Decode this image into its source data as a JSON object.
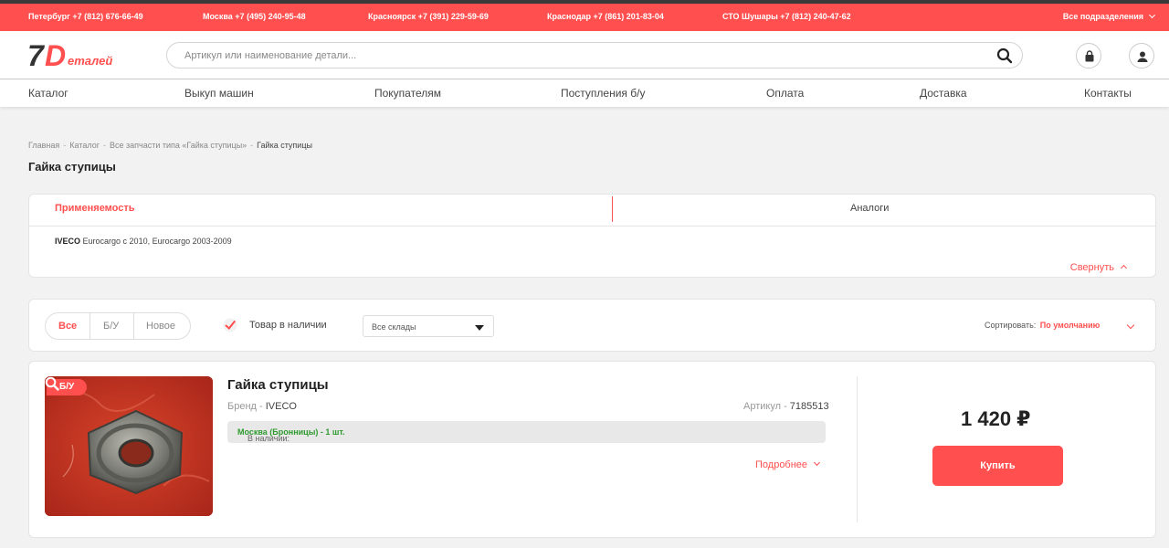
{
  "topbar": {
    "phones": [
      "Петербург +7 (812) 676-66-49",
      "Москва +7 (495) 240-95-48",
      "Красноярск +7 (391) 229-59-69",
      "Краснодар +7 (861) 201-83-04",
      "СТО Шушары +7 (812) 240-47-62"
    ],
    "all_divisions": "Все подразделения"
  },
  "logo": {
    "seven": "7",
    "d": "D",
    "rest": "еталей"
  },
  "search": {
    "placeholder": "Артикул или наименование детали..."
  },
  "nav": [
    "Каталог",
    "Выкуп машин",
    "Покупателям",
    "Поступления б/у",
    "Оплата",
    "Доставка",
    "Контакты"
  ],
  "breadcrumb": {
    "items": [
      "Главная",
      "Каталог",
      "Все запчасти типа «Гайка ступицы»"
    ],
    "current": "Гайка ступицы"
  },
  "page_title": "Гайка ступицы",
  "applicability": {
    "tab_active": "Применяемость",
    "tab_other": "Аналоги",
    "brand": "IVECO",
    "models": "Eurocargo с 2010, Eurocargo 2003-2009",
    "collapse": "Свернуть"
  },
  "filters": {
    "segments": [
      "Все",
      "Б/У",
      "Новое"
    ],
    "in_stock": "Товар в наличии",
    "warehouse": "Все склады",
    "sort_label": "Сортировать:",
    "sort_value": "По умолчанию"
  },
  "product": {
    "badge": "Б/У",
    "title": "Гайка ступицы",
    "brand_label": "Бренд - ",
    "brand": "IVECO",
    "article_label": "Артикул - ",
    "article": "7185513",
    "avail_label": "В наличии: ",
    "avail_value": "Москва (Бронницы) - 1 шт.",
    "more": "Подробнее",
    "price": "1 420 ₽",
    "buy": "Купить"
  },
  "colors": {
    "accent": "#ff4f4f",
    "green": "#2e9a2e"
  }
}
